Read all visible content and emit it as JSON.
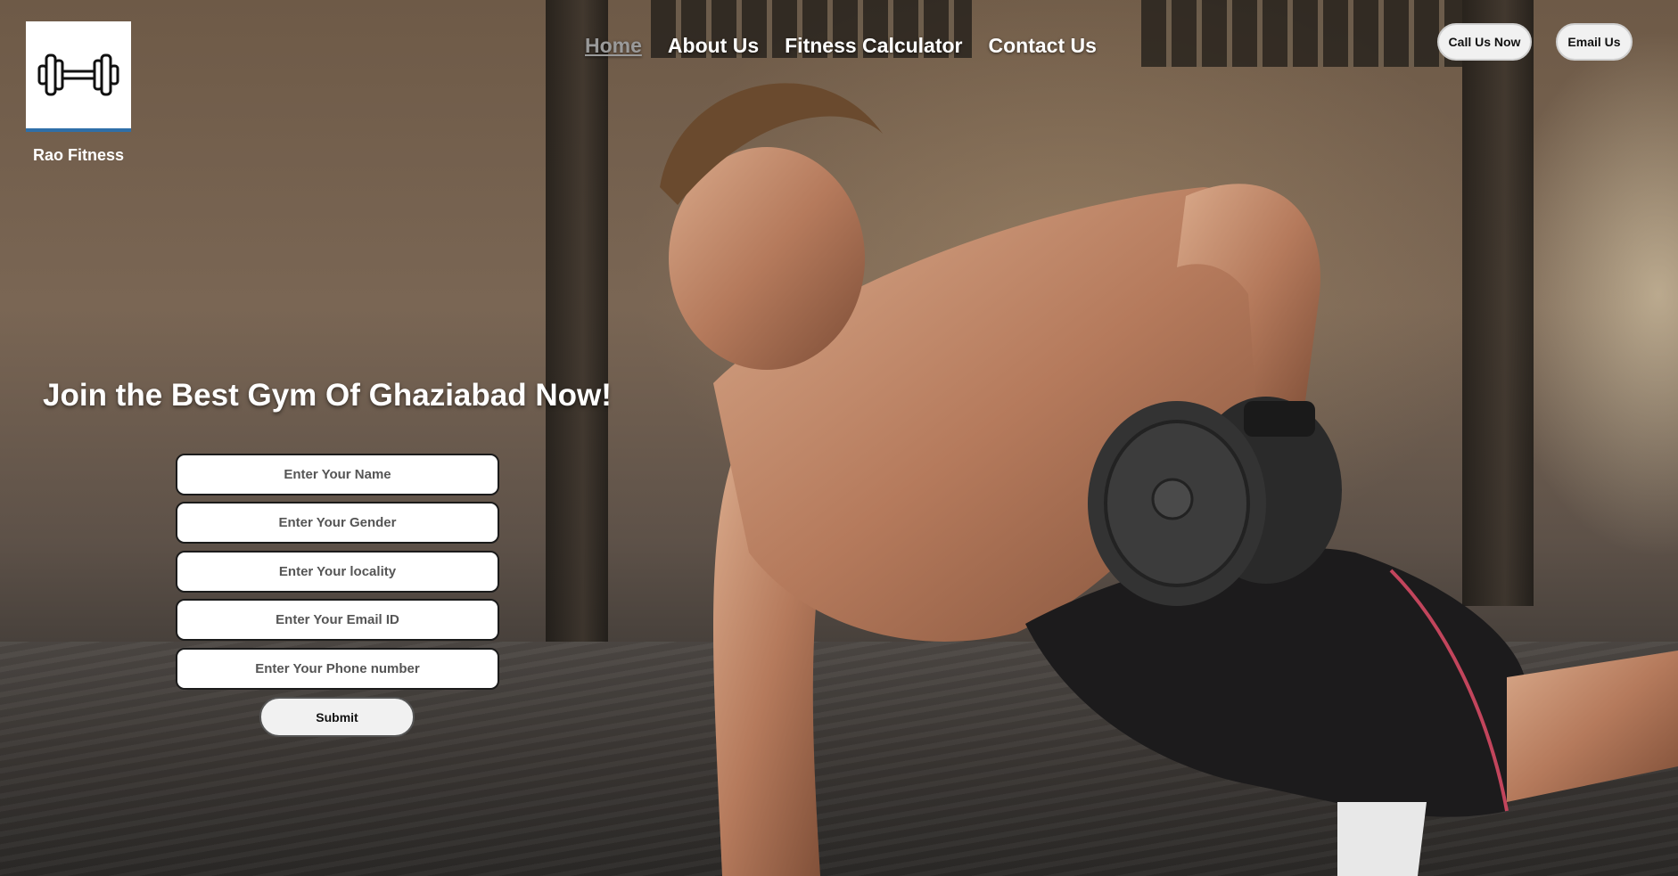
{
  "brand": {
    "name": "Rao Fitness",
    "logo_icon": "dumbbell-icon"
  },
  "nav": {
    "items": [
      {
        "label": "Home",
        "active": true
      },
      {
        "label": "About Us",
        "active": false
      },
      {
        "label": "Fitness Calculator",
        "active": false
      },
      {
        "label": "Contact Us",
        "active": false
      }
    ]
  },
  "actions": {
    "call_label": "Call Us Now",
    "email_label": "Email Us"
  },
  "hero": {
    "headline": "Join the Best Gym Of Ghaziabad Now!"
  },
  "form": {
    "name_placeholder": "Enter Your Name",
    "gender_placeholder": "Enter Your Gender",
    "locality_placeholder": "Enter Your locality",
    "email_placeholder": "Enter Your Email ID",
    "phone_placeholder": "Enter Your Phone number",
    "submit_label": "Submit"
  },
  "colors": {
    "nav_active": "#9a9a9a",
    "nav_text": "#ffffff",
    "button_bg": "#f1f1f1"
  }
}
